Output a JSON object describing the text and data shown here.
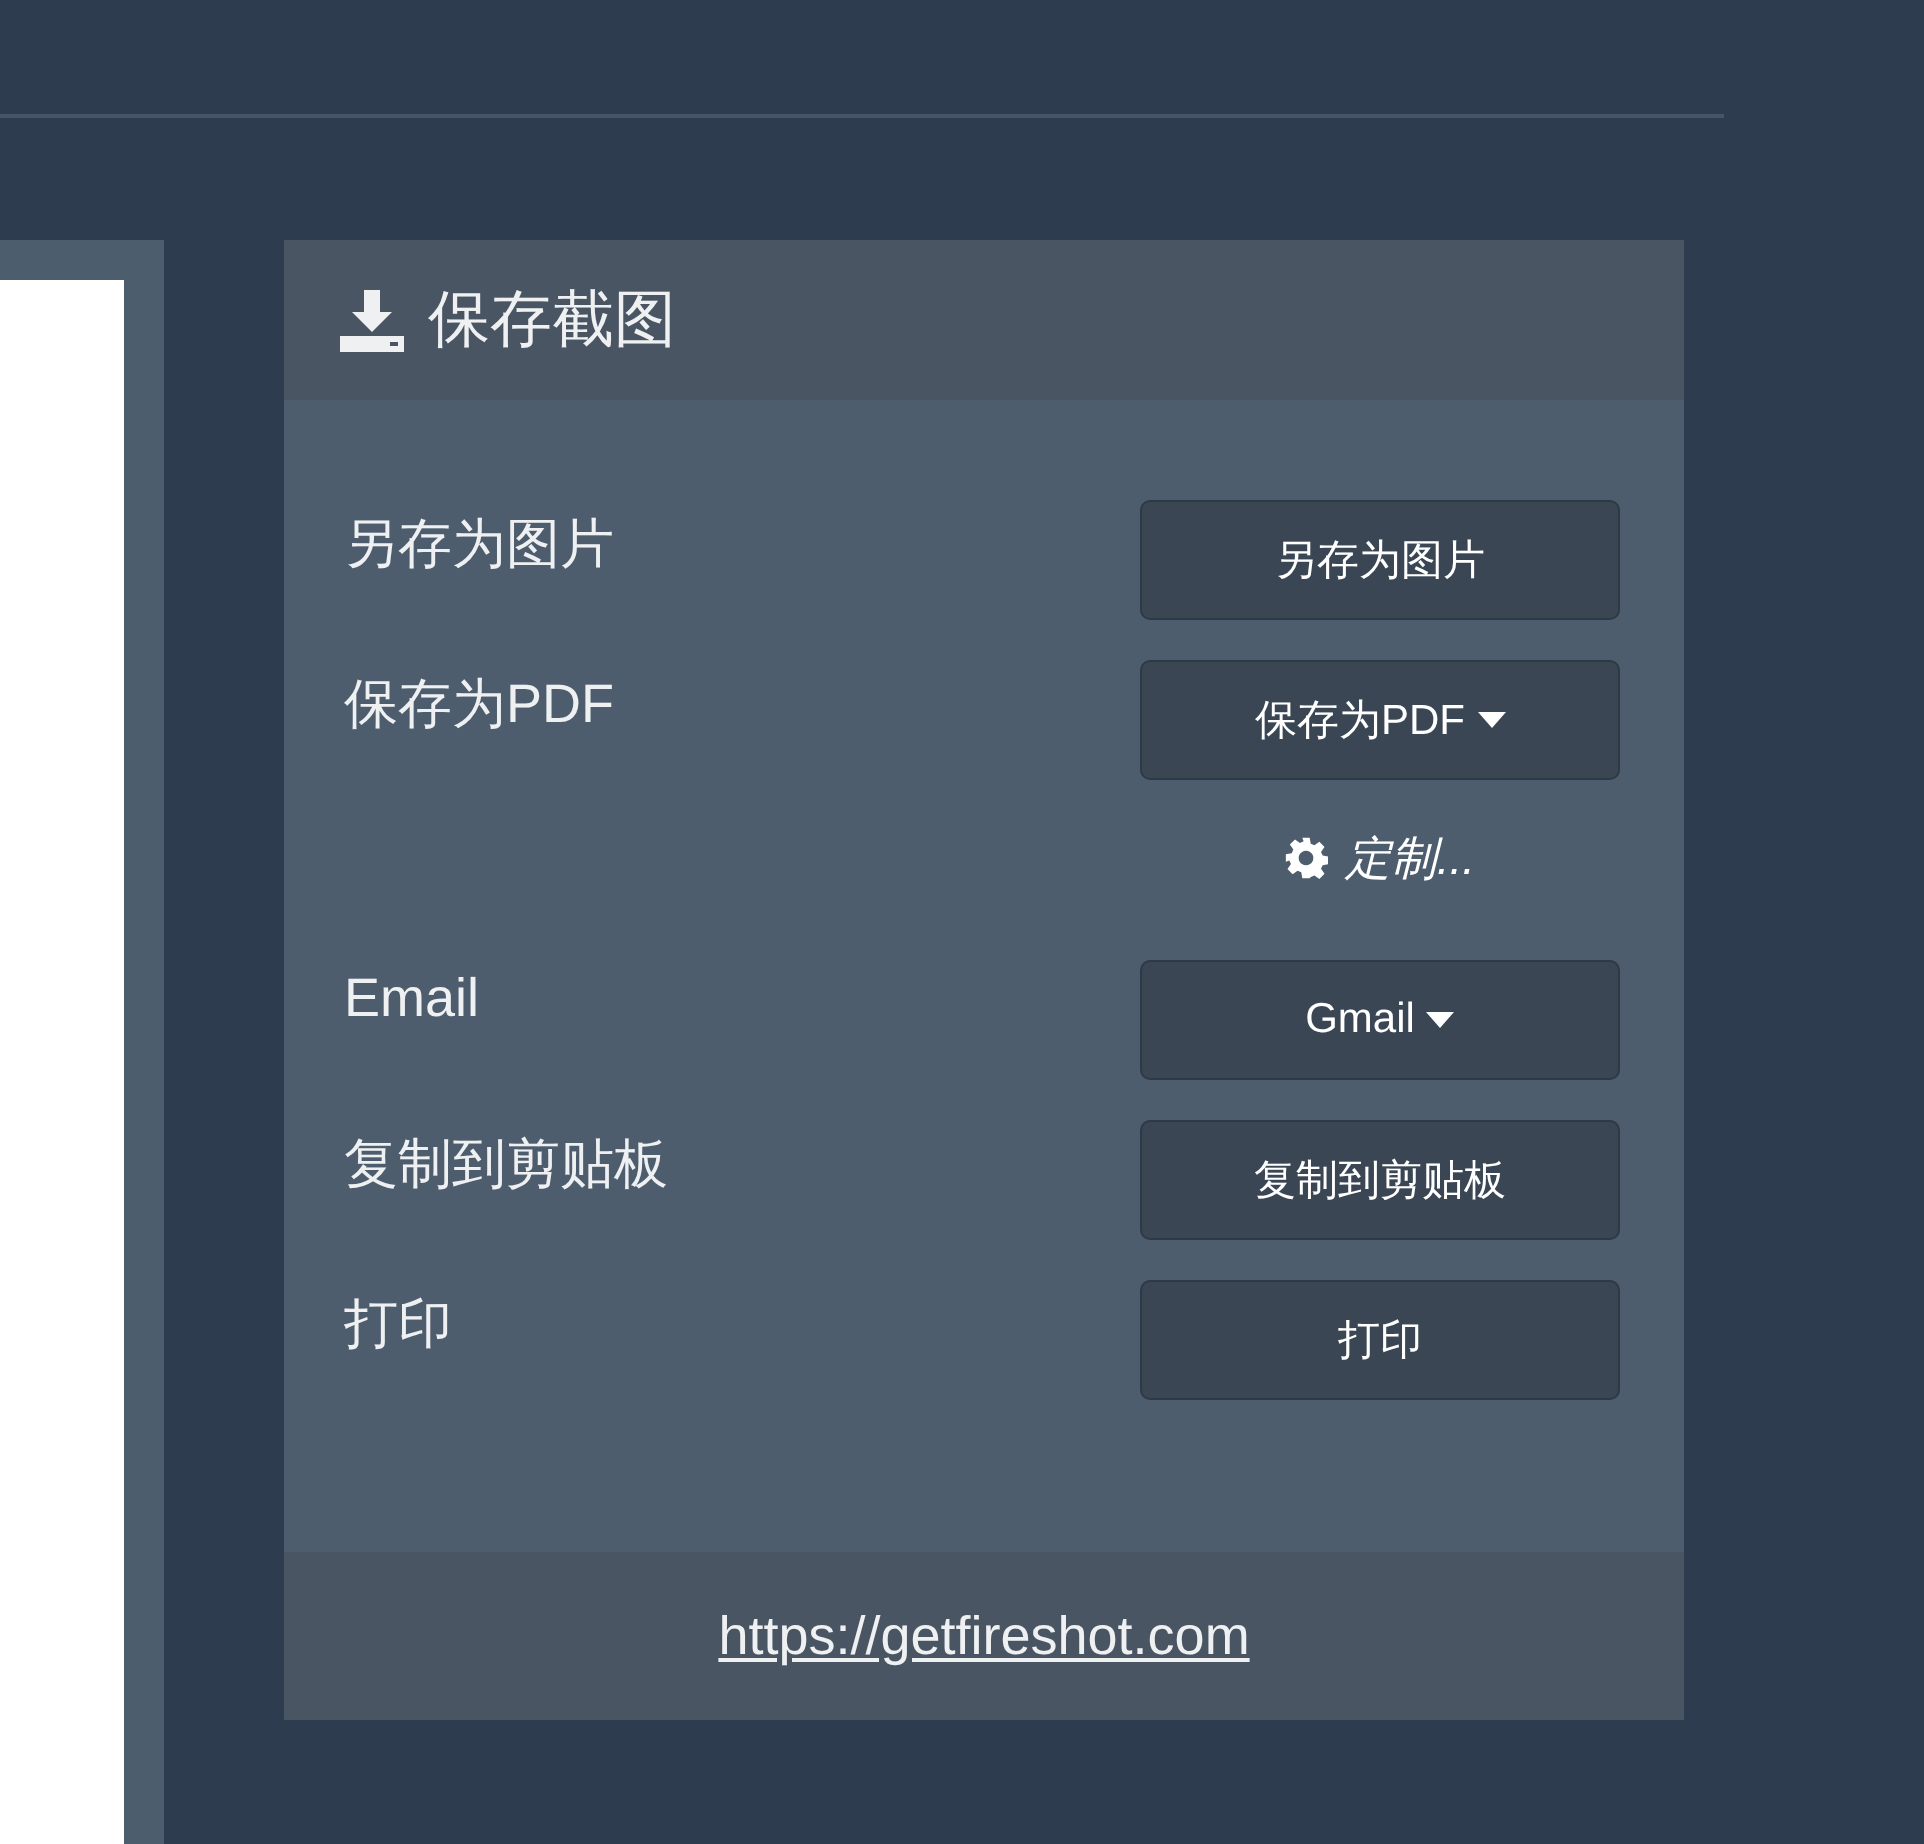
{
  "panel": {
    "title": "保存截图",
    "rows": [
      {
        "label": "另存为图片",
        "button": "另存为图片",
        "has_menu": false
      },
      {
        "label": "保存为PDF",
        "button": "保存为PDF",
        "has_menu": true,
        "option_link": "定制..."
      },
      {
        "label": "Email",
        "button": "Gmail",
        "has_menu": true
      },
      {
        "label": "复制到剪贴板",
        "button": "复制到剪贴板",
        "has_menu": false
      },
      {
        "label": "打印",
        "button": "打印",
        "has_menu": false
      }
    ],
    "footer_link": "https://getfireshot.com"
  }
}
